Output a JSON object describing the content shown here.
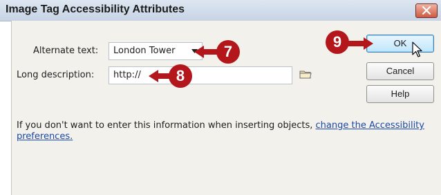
{
  "dialog": {
    "title": "Image Tag Accessibility Attributes"
  },
  "fields": {
    "alt_label": "Alternate text:",
    "alt_value": "London Tower",
    "longdesc_label": "Long description:",
    "longdesc_value": "http://"
  },
  "buttons": {
    "ok": "OK",
    "cancel": "Cancel",
    "help": "Help"
  },
  "info": {
    "text": "If you don't want to enter this information when inserting objects, ",
    "link": "change the Accessibility preferences."
  },
  "callouts": {
    "step_7": "7",
    "step_8": "8",
    "step_9": "9"
  },
  "colors": {
    "callout": "#b3161b",
    "link": "#1b48a8",
    "panel": "#f2f1eb"
  }
}
